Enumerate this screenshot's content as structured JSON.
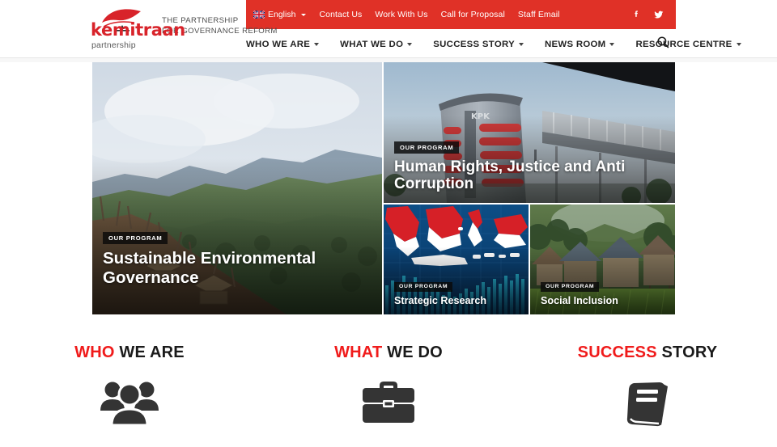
{
  "site": {
    "logo_name": "kemitraan",
    "logo_subtitle": "partnership",
    "tagline_line1": "THE PARTNERSHIP",
    "tagline_line2": "FOR GOVERNANCE REFORM",
    "brand_red": "#d8232a",
    "topbar_red": "#e03127",
    "accent_red": "#f01b1b"
  },
  "topbar": {
    "language": "English",
    "language_flag_icon": "uk-flag-icon",
    "links": [
      {
        "label": "Contact Us"
      },
      {
        "label": "Work With Us"
      },
      {
        "label": "Call for Proposal"
      },
      {
        "label": "Staff Email"
      }
    ],
    "social": [
      {
        "name": "facebook-icon"
      },
      {
        "name": "twitter-icon"
      }
    ]
  },
  "mainnav": {
    "items": [
      {
        "label": "WHO WE ARE",
        "has_dropdown": true
      },
      {
        "label": "WHAT WE DO",
        "has_dropdown": true
      },
      {
        "label": "SUCCESS STORY",
        "has_dropdown": true
      },
      {
        "label": "NEWS ROOM",
        "has_dropdown": true
      },
      {
        "label": "RESOURCE CENTRE",
        "has_dropdown": true
      }
    ],
    "search_icon": "search-icon"
  },
  "hero": {
    "badge_label": "OUR PROGRAM",
    "tiles": [
      {
        "title": "Sustainable Environmental Governance",
        "badge": "OUR PROGRAM"
      },
      {
        "title": "Human Rights, Justice and Anti Corruption",
        "badge": "OUR PROGRAM"
      },
      {
        "title": "Strategic Research",
        "badge": "OUR PROGRAM"
      },
      {
        "title": "Social Inclusion",
        "badge": "OUR PROGRAM"
      }
    ]
  },
  "features": [
    {
      "first_word": "WHO",
      "rest": " WE ARE",
      "icon": "people-group-icon"
    },
    {
      "first_word": "WHAT",
      "rest": " WE DO",
      "icon": "briefcase-icon"
    },
    {
      "first_word": "SUCCESS",
      "rest": " STORY",
      "icon": "book-icon"
    }
  ]
}
